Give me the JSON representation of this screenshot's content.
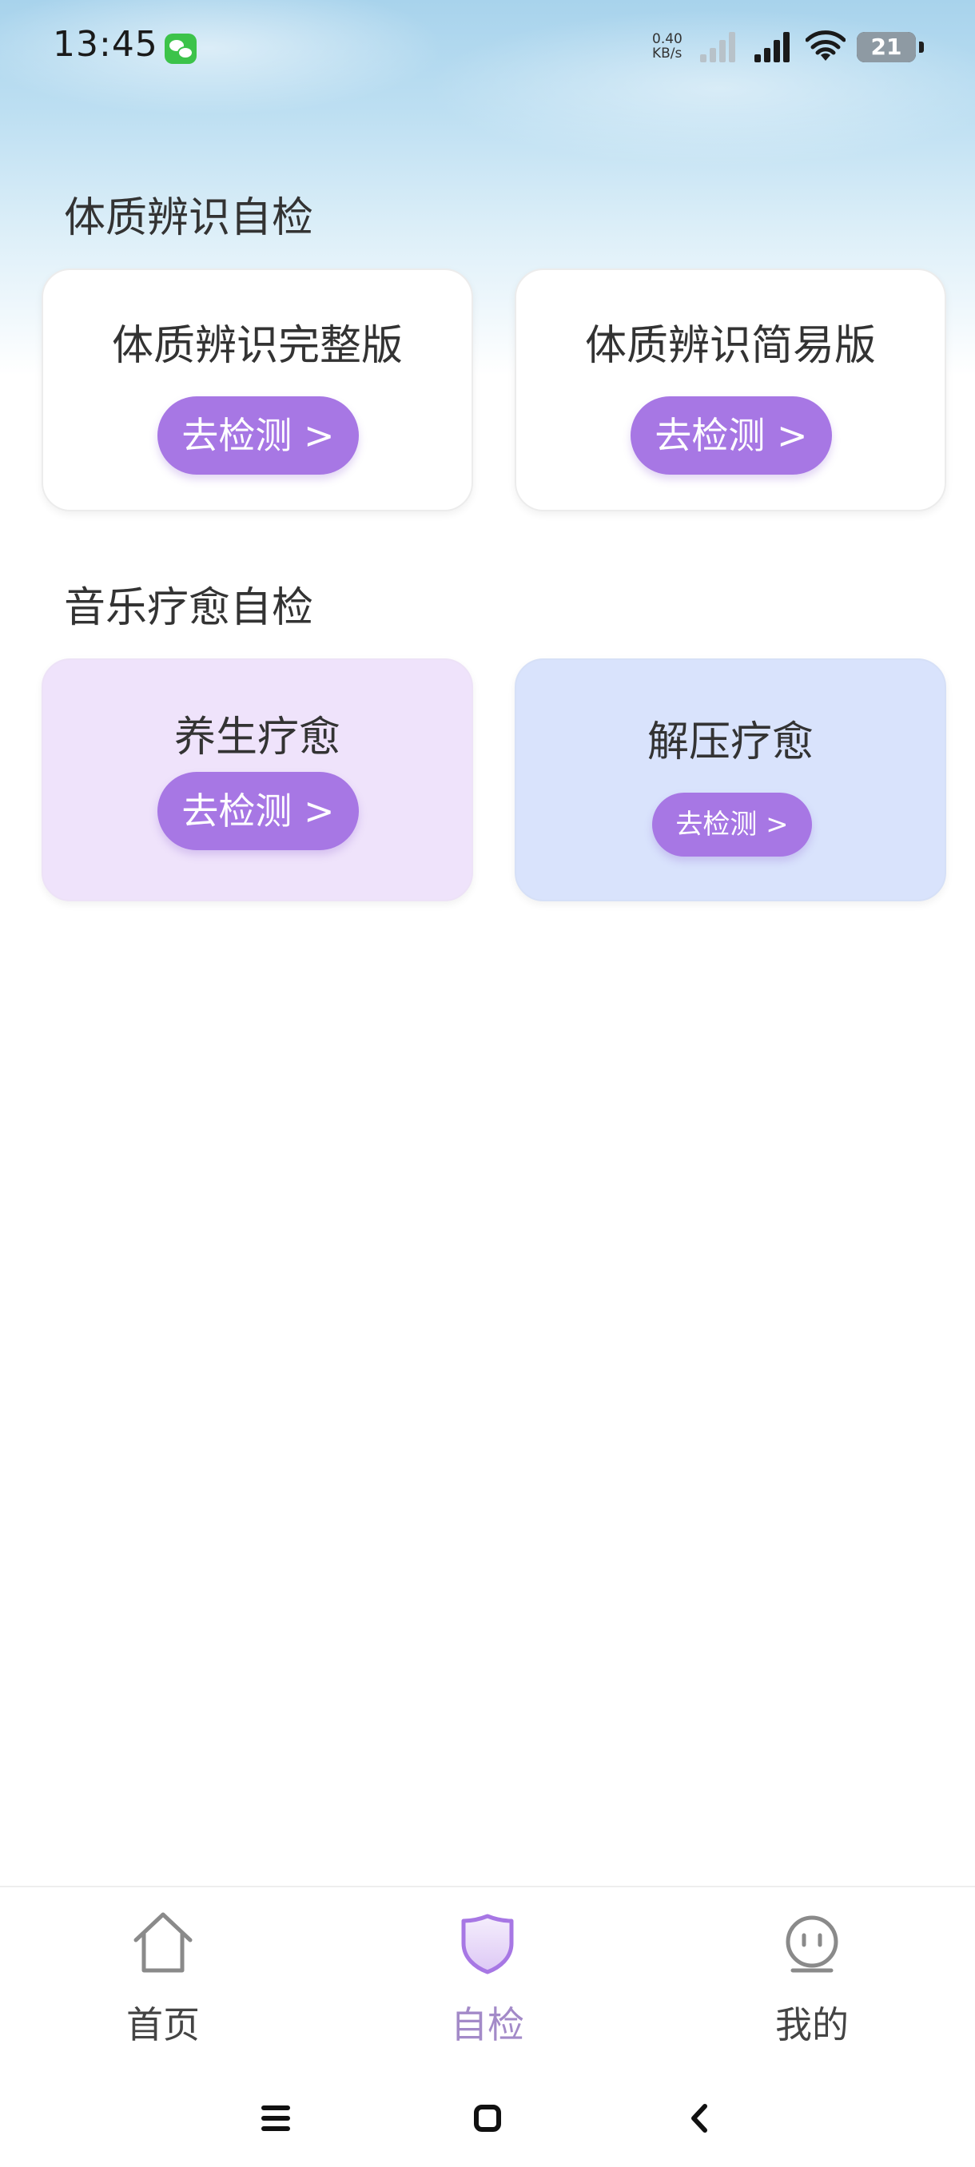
{
  "status_bar": {
    "time": "13:45",
    "net_speed_value": "0.40",
    "net_speed_unit": "KB/s",
    "battery_level": "21"
  },
  "sections": [
    {
      "title": "体质辨识自检",
      "cards": [
        {
          "title": "体质辨识完整版",
          "button_label": "去检测 >"
        },
        {
          "title": "体质辨识简易版",
          "button_label": "去检测 >"
        }
      ]
    },
    {
      "title": "音乐疗愈自检",
      "cards": [
        {
          "title": "养生疗愈",
          "button_label": "去检测 >"
        },
        {
          "title": "解压疗愈",
          "button_label": "去检测 >"
        }
      ]
    }
  ],
  "bottom_nav": {
    "items": [
      {
        "label": "首页",
        "icon": "home-icon"
      },
      {
        "label": "自检",
        "icon": "shield-icon",
        "active": true
      },
      {
        "label": "我的",
        "icon": "smiley-face-icon"
      }
    ]
  },
  "system_nav": {
    "icons": [
      "menu-icon",
      "home-square-icon",
      "back-chevron-icon"
    ]
  },
  "colors": {
    "accent_button": "#a777e4",
    "active_nav": "#a38ac8",
    "card_wellness_bg": "#efe3fb",
    "card_relief_bg": "#d9e3fc"
  }
}
